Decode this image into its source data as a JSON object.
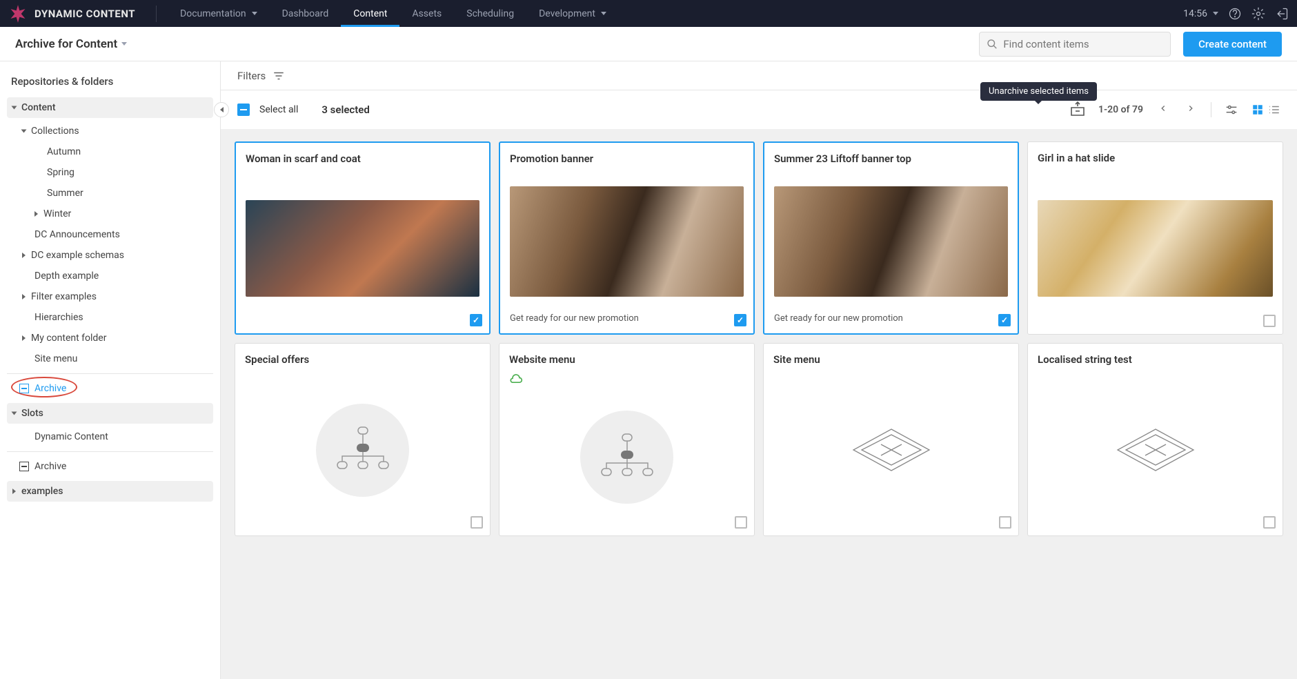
{
  "topbar": {
    "brand": "DYNAMIC CONTENT",
    "nav": {
      "documentation": "Documentation",
      "dashboard": "Dashboard",
      "content": "Content",
      "assets": "Assets",
      "scheduling": "Scheduling",
      "development": "Development"
    },
    "time": "14:56"
  },
  "subheader": {
    "crumb": "Archive for Content",
    "search_placeholder": "Find content items",
    "create_label": "Create content"
  },
  "sidebar": {
    "title": "Repositories & folders",
    "content_label": "Content",
    "content_children": {
      "collections": "Collections",
      "autumn": "Autumn",
      "spring": "Spring",
      "summer": "Summer",
      "winter": "Winter",
      "dc_ann": "DC Announcements",
      "dc_schemas": "DC example schemas",
      "depth": "Depth example",
      "filter_ex": "Filter examples",
      "hier": "Hierarchies",
      "my_folder": "My content folder",
      "site_menu": "Site menu",
      "archive": "Archive"
    },
    "slots_label": "Slots",
    "slots_children": {
      "dc": "Dynamic Content",
      "archive2": "Archive"
    },
    "examples_label": "examples"
  },
  "filters": {
    "label": "Filters"
  },
  "selbar": {
    "select_all": "Select all",
    "selected_text": "3 selected",
    "tooltip": "Unarchive selected items",
    "pager": "1-20 of 79"
  },
  "cards": {
    "c1": {
      "title": "Woman in scarf and coat"
    },
    "c2": {
      "title": "Promotion banner",
      "caption": "Get ready for our new promotion"
    },
    "c3": {
      "title": "Summer 23 Liftoff banner top",
      "caption": "Get ready for our new promotion"
    },
    "c4": {
      "title": "Girl in a hat slide"
    },
    "c5": {
      "title": "Special offers"
    },
    "c6": {
      "title": "Website menu"
    },
    "c7": {
      "title": "Site menu"
    },
    "c8": {
      "title": "Localised string test"
    }
  }
}
